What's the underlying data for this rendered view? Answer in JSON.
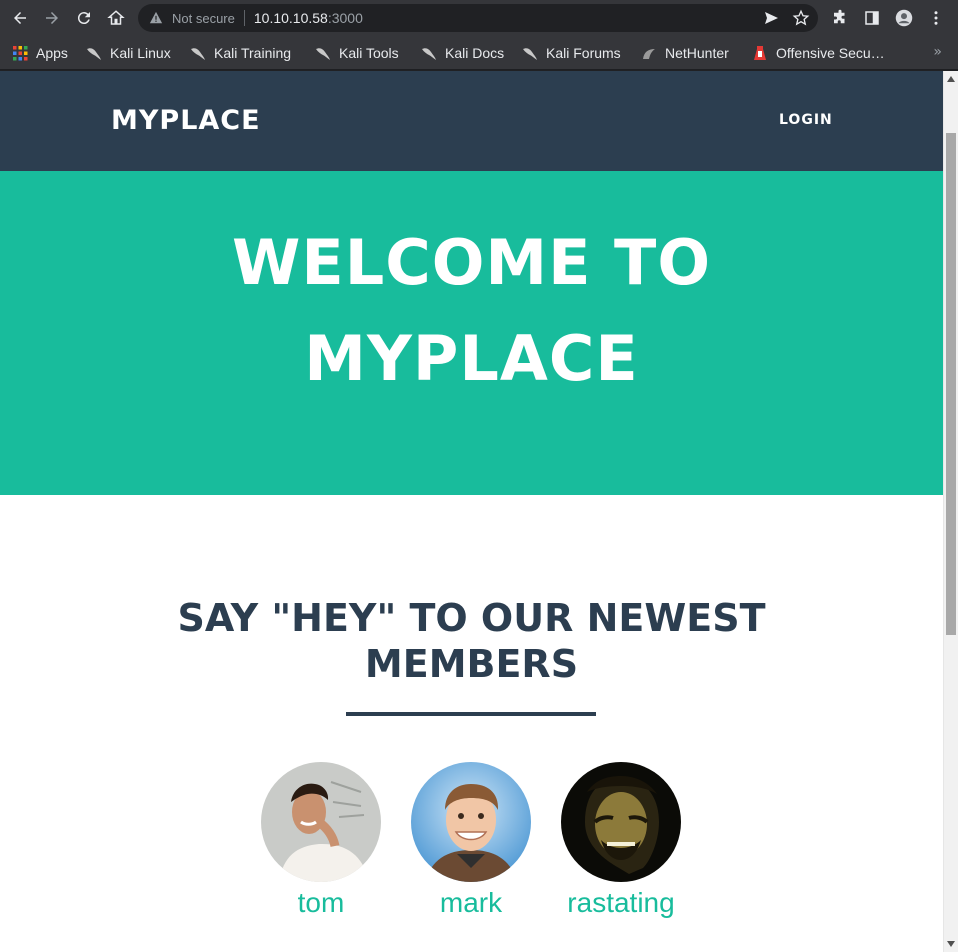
{
  "browser": {
    "security_label": "Not secure",
    "url_host": "10.10.10.58",
    "url_port": ":3000",
    "bookmarks": [
      {
        "label": "Apps",
        "icon": "apps-grid-icon"
      },
      {
        "label": "Kali Linux",
        "icon": "kali-dragon-icon"
      },
      {
        "label": "Kali Training",
        "icon": "kali-dragon-icon"
      },
      {
        "label": "Kali Tools",
        "icon": "kali-dragon-icon"
      },
      {
        "label": "Kali Docs",
        "icon": "kali-dragon-icon"
      },
      {
        "label": "Kali Forums",
        "icon": "kali-dragon-icon"
      },
      {
        "label": "NetHunter",
        "icon": "nethunter-icon"
      },
      {
        "label": "Offensive Secu…",
        "icon": "offsec-icon"
      }
    ],
    "bookmarks_overflow": "»"
  },
  "page": {
    "brand": "MYPLACE",
    "nav_login": "LOGIN",
    "hero_line1": "WELCOME TO",
    "hero_line2": "MYPLACE",
    "members_heading_line1": "SAY \"HEY\" TO OUR NEWEST",
    "members_heading_line2": "MEMBERS",
    "members": [
      {
        "name": "tom"
      },
      {
        "name": "mark"
      },
      {
        "name": "rastating"
      }
    ]
  },
  "colors": {
    "navbar": "#2c3e50",
    "accent": "#18bc9c",
    "text_dark": "#2c3e50"
  }
}
